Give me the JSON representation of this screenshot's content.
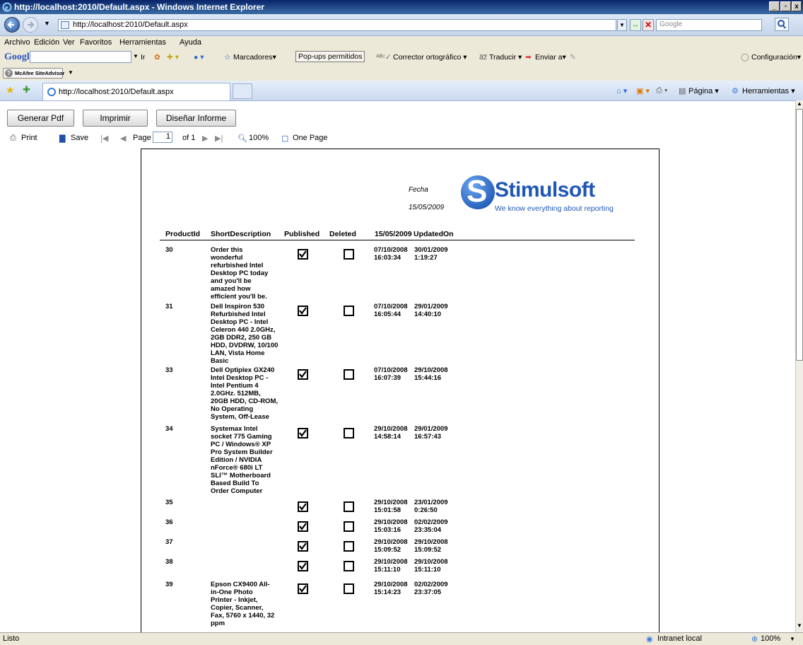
{
  "window": {
    "title": "http://localhost:2010/Default.aspx - Windows Internet Explorer"
  },
  "address_bar": {
    "url": "http://localhost:2010/Default.aspx",
    "search_placeholder": "Google"
  },
  "menu": [
    "Archivo",
    "Edición",
    "Ver",
    "Favoritos",
    "Herramientas",
    "Ayuda"
  ],
  "google_toolbar": {
    "logo": "Google",
    "go_label": "Ir",
    "items": [
      "Marcadores▾",
      "Pop-ups permitidos",
      "Corrector ortográfico ▾",
      "Traducir ▾",
      "Enviar a▾"
    ],
    "settings": "Configuración▾"
  },
  "mcafee": {
    "label": "McAfee SiteAdvisor"
  },
  "tab": {
    "title": "http://localhost:2010/Default.aspx"
  },
  "command_bar": {
    "page": "Página ▾",
    "tools": "Herramientas ▾"
  },
  "buttons": {
    "generate_pdf": "Generar Pdf",
    "print": "Imprimir",
    "design": "Diseñar Informe"
  },
  "viewer": {
    "print": "Print",
    "save": "Save",
    "page_label": "Page",
    "page_value": "1",
    "of_label": "of 1",
    "zoom": "100%",
    "one_page": "One Page"
  },
  "report": {
    "logo_text": "Stimulsoft",
    "logo_tagline": "We know everything about reporting",
    "date_label": "Fecha",
    "date_value": "15/05/2009",
    "headers": [
      "ProductId",
      "ShortDescription",
      "Published",
      "Deleted",
      "15/05/2009",
      "UpdatedOn"
    ],
    "rows": [
      {
        "id": "30",
        "desc": "Order this\nwonderful\nrefurbished Intel\nDesktop PC today\nand you'll be\namazed how\nefficient you'll be.",
        "published": true,
        "deleted": false,
        "created": "07/10/2008\n16:03:34",
        "updated": "30/01/2009\n1:19:27"
      },
      {
        "id": "31",
        "desc": "Dell Inspiron 530\nRefurbished Intel\nDesktop PC - Intel\nCeleron 440 2.0GHz,\n2GB DDR2, 250 GB\nHDD, DVDRW, 10/100\nLAN, Vista Home\nBasic",
        "published": true,
        "deleted": false,
        "created": "07/10/2008\n16:05:44",
        "updated": "29/01/2009\n14:40:10"
      },
      {
        "id": "33",
        "desc": "Dell Optiplex GX240\nIntel Desktop PC -\nIntel Pentium 4\n2.0GHz. 512MB,\n20GB HDD, CD-ROM,\nNo Operating\nSystem, Off-Lease",
        "published": true,
        "deleted": false,
        "created": "07/10/2008\n16:07:39",
        "updated": "29/10/2008\n15:44:16"
      },
      {
        "id": "34",
        "desc": "Systemax Intel\nsocket 775 Gaming\nPC / Windows® XP\nPro System Builder\nEdition / NVIDIA\nnForce® 680i LT\nSLI™ Motherboard\nBased Build To\nOrder Computer",
        "published": true,
        "deleted": false,
        "created": "29/10/2008\n14:58:14",
        "updated": "29/01/2009\n16:57:43"
      },
      {
        "id": "35",
        "desc": "",
        "published": true,
        "deleted": false,
        "created": "29/10/2008\n15:01:58",
        "updated": "23/01/2009\n0:26:50"
      },
      {
        "id": "36",
        "desc": "",
        "published": true,
        "deleted": false,
        "created": "29/10/2008\n15:03:16",
        "updated": "02/02/2009\n23:35:04"
      },
      {
        "id": "37",
        "desc": "",
        "published": true,
        "deleted": false,
        "created": "29/10/2008\n15:09:52",
        "updated": "29/10/2008\n15:09:52"
      },
      {
        "id": "38",
        "desc": "",
        "published": true,
        "deleted": false,
        "created": "29/10/2008\n15:11:10",
        "updated": "29/10/2008\n15:11:10"
      },
      {
        "id": "39",
        "desc": "Epson CX9400 All-\nin-One Photo\nPrinter - Inkjet,\nCopier, Scanner,\nFax, 5760 x 1440, 32\nppm",
        "published": true,
        "deleted": false,
        "created": "29/10/2008\n15:14:23",
        "updated": "02/02/2009\n23:37:05"
      }
    ]
  },
  "status": {
    "left": "Listo",
    "zone": "Intranet local",
    "zoom": "100%"
  }
}
